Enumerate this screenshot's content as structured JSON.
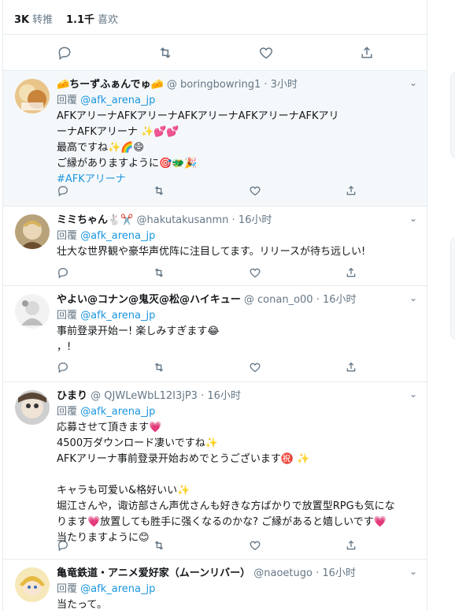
{
  "stats": {
    "retweets_count": "3K",
    "retweets_label": "转推",
    "likes_count": "1.1千",
    "likes_label": "喜欢"
  },
  "replies": [
    {
      "name": "🧀ちーずふぁんでゅ🧀",
      "handle": "@ boringbowring1",
      "sep": "·",
      "time": "3小时",
      "reply_prefix": "回覆",
      "reply_to": "@afk_arena_jp",
      "line1": "AFKアリーナAFKアリーナAFKアリーナAFKアリーナAFKアリ",
      "line2": "ーナAFKアリーナ ✨💕💕",
      "line3": "最高ですね✨🌈😄",
      "line4": "ご縁がありますように🎯🐲🎉",
      "hashtag": "#AFKアリーナ"
    },
    {
      "name": "ミミちゃん🐇✂️",
      "handle": "@hakutakusanmn",
      "sep": "·",
      "time": "16小时",
      "reply_prefix": "回覆",
      "reply_to": "@afk_arena_jp",
      "line1": "壮大な世界観や豪华声优阵に注目してます。リリースが待ち远しい!"
    },
    {
      "name": "やよい@コナン@鬼灭@松@ハイキュー",
      "handle": "@ conan_o00",
      "sep": "·",
      "time": "16小时",
      "reply_prefix": "回覆",
      "reply_to": "@afk_arena_jp",
      "line1": "事前登录开始ー! 楽しみすぎます😂",
      "line2": "，!"
    },
    {
      "name": "ひまり",
      "handle": "@ QJWLeWbL12I3jP3",
      "sep": "·",
      "time": "16小时",
      "reply_prefix": "回覆",
      "reply_to": "@afk_arena_jp",
      "line1": "応募させて頂きます💗",
      "line2": "4500万ダウンロード凄いですね✨",
      "line3": "AFKアリーナ事前登录开始おめでとうございます㊗️ ✨",
      "line4": "キャラも可爱い&格好いい✨",
      "line5": "堀江さんや，诹访部さん声优さんも好きな方ばかりで放置型RPGも気にな",
      "line6": "ります💗放置しても胜手に强くなるのかな? ご縁があると嬉しいです💗",
      "line7": "当たりますように😊"
    },
    {
      "name": "亀竜鉄道・アニメ爱好家（ムーンリバー）",
      "handle": "@naoetugo",
      "sep": "·",
      "time": "16小时",
      "reply_prefix": "回覆",
      "reply_to": "@afk_arena_jp",
      "line1": "当たって。"
    }
  ],
  "icons": [
    "reply-icon",
    "retweet-icon",
    "like-icon",
    "share-icon",
    "chevron-down-icon"
  ],
  "colors": {
    "link": "#1b95e0",
    "muted": "#657786",
    "highlight_bg": "#f5f8fa",
    "border": "#e6ecf0"
  }
}
